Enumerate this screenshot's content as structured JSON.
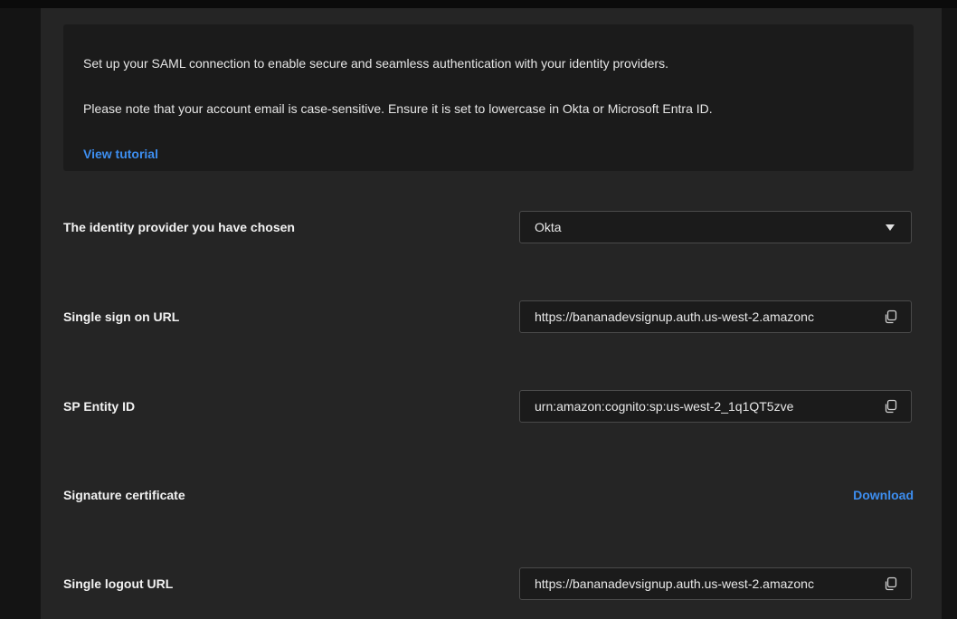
{
  "info": {
    "line1": "Set up your SAML connection to enable secure and seamless authentication with your identity providers.",
    "line2": "Please note that your account email is case-sensitive. Ensure it is set to lowercase in Okta or Microsoft Entra ID.",
    "tutorial_link": "View tutorial"
  },
  "fields": {
    "identity_provider": {
      "label": "The identity provider you have chosen",
      "value": "Okta"
    },
    "sso_url": {
      "label": "Single sign on URL",
      "value": "https://bananadevsignup.auth.us-west-2.amazonc"
    },
    "sp_entity_id": {
      "label": "SP Entity ID",
      "value": "urn:amazon:cognito:sp:us-west-2_1q1QT5zve"
    },
    "signature_certificate": {
      "label": "Signature certificate",
      "action": "Download"
    },
    "logout_url": {
      "label": "Single logout URL",
      "value": "https://bananadevsignup.auth.us-west-2.amazonc"
    }
  },
  "colors": {
    "page_background": "#141414",
    "panel_background": "#252525",
    "box_background": "#1b1b1b",
    "link": "#3d8ef0"
  },
  "icons": {
    "copy": "copy-icon",
    "dropdown": "chevron-down-icon"
  }
}
